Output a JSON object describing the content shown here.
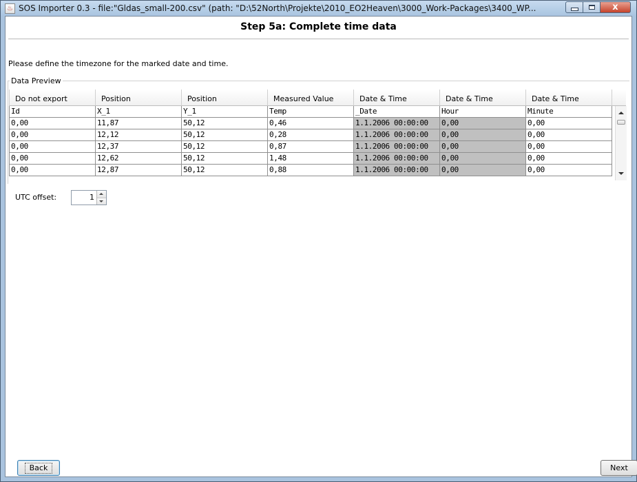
{
  "window": {
    "title": "SOS Importer 0.3 - file:\"Gldas_small-200.csv\" (path: \"D:\\52North\\Projekte\\2010_EO2Heaven\\3000_Work-Packages\\3400_WP...",
    "close_symbol": "x"
  },
  "step": {
    "title": "Step 5a: Complete time data",
    "instruction": "Please define the timezone for the marked date and time."
  },
  "preview": {
    "label": "Data Preview",
    "headers": [
      "Do not export",
      "Position",
      "Position",
      "Measured Value",
      "Date & Time",
      "Date & Time",
      "Date & Time"
    ],
    "marked_columns": [
      4,
      5
    ],
    "rows": [
      [
        "Id",
        "X_1",
        "Y_1",
        "Temp",
        "_Date",
        "Hour",
        "Minute"
      ],
      [
        "0,00",
        "11,87",
        "50,12",
        "0,46",
        "1.1.2006 00:00:00",
        "0,00",
        "0,00"
      ],
      [
        "0,00",
        "12,12",
        "50,12",
        "0,28",
        "1.1.2006 00:00:00",
        "0,00",
        "0,00"
      ],
      [
        "0,00",
        "12,37",
        "50,12",
        "0,87",
        "1.1.2006 00:00:00",
        "0,00",
        "0,00"
      ],
      [
        "0,00",
        "12,62",
        "50,12",
        "1,48",
        "1.1.2006 00:00:00",
        "0,00",
        "0,00"
      ],
      [
        "0,00",
        "12,87",
        "50,12",
        "0,88",
        "1.1.2006 00:00:00",
        "0,00",
        "0,00"
      ]
    ]
  },
  "utc": {
    "label": "UTC offset:",
    "value": "1"
  },
  "buttons": {
    "back": "Back",
    "next": "Next"
  },
  "icons": {
    "app": "java-app-icon",
    "minimize": "minimize-icon",
    "maximize": "maximize-icon",
    "close": "close-icon"
  }
}
